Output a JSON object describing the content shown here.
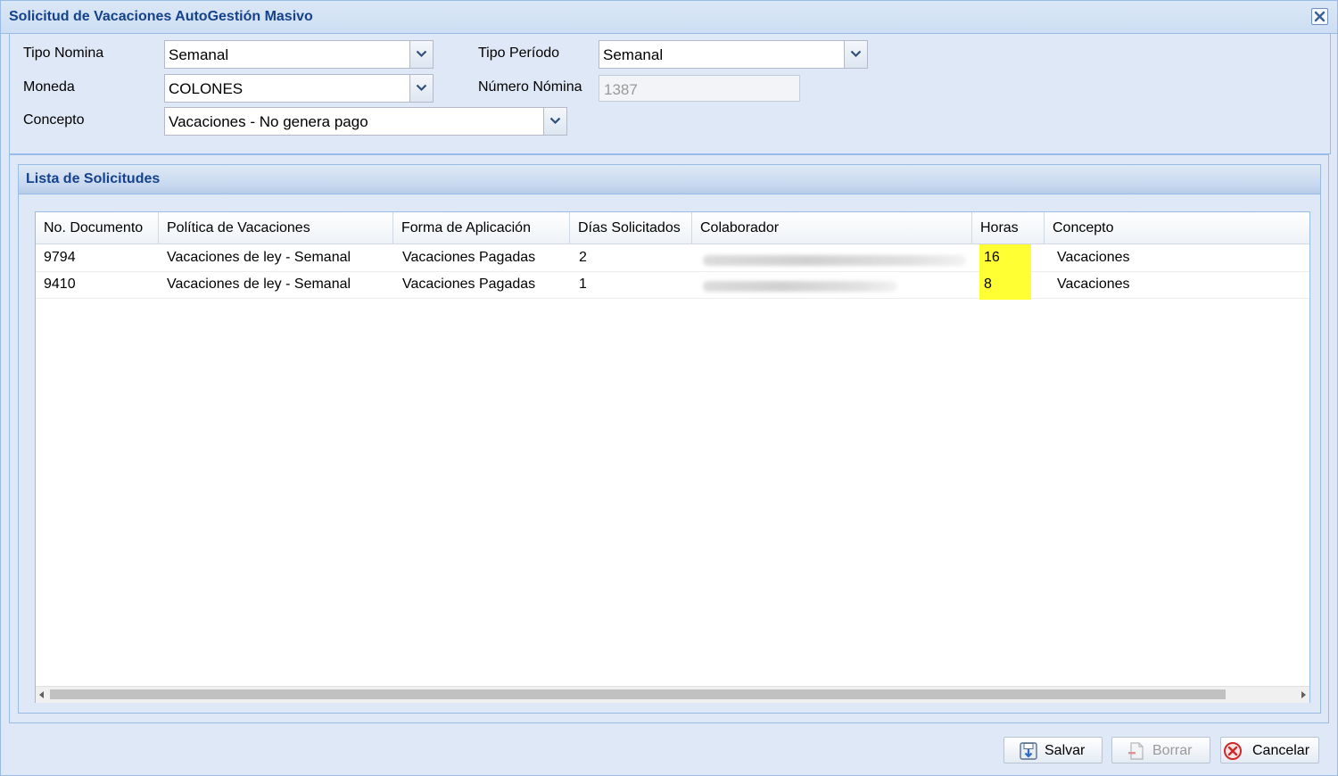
{
  "window": {
    "title": "Solicitud de Vacaciones AutoGestión Masivo"
  },
  "form": {
    "tipo_nomina": {
      "label": "Tipo Nomina",
      "value": "Semanal"
    },
    "tipo_periodo": {
      "label": "Tipo Período",
      "value": "Semanal"
    },
    "moneda": {
      "label": "Moneda",
      "value": "COLONES"
    },
    "numero_nomina": {
      "label": "Número Nómina",
      "value": "1387"
    },
    "concepto": {
      "label": "Concepto",
      "value": "Vacaciones - No genera pago"
    }
  },
  "list": {
    "title": "Lista de Solicitudes",
    "columns": [
      "No. Documento",
      "Política de Vacaciones",
      "Forma de Aplicación",
      "Días Solicitados",
      "Colaborador",
      "Horas",
      "Concepto"
    ],
    "rows": [
      {
        "documento": "9794",
        "politica": "Vacaciones de ley - Semanal",
        "forma": "Vacaciones Pagadas",
        "dias": "2",
        "colaborador": "",
        "horas": "16",
        "concepto": "Vacaciones"
      },
      {
        "documento": "9410",
        "politica": "Vacaciones de ley - Semanal",
        "forma": "Vacaciones Pagadas",
        "dias": "1",
        "colaborador": "",
        "horas": "8",
        "concepto": "Vacaciones"
      }
    ]
  },
  "buttons": {
    "save": "Salvar",
    "delete": "Borrar",
    "cancel": "Cancelar"
  },
  "colors": {
    "title": "#15428b",
    "highlight": "#ffff33",
    "panel": "#dfe8f6",
    "border": "#99bbe8"
  },
  "icons": {
    "close": "close-icon",
    "save": "save-icon",
    "delete": "delete-icon",
    "cancel": "cancel-icon",
    "dropdown": "chevron-down-icon"
  }
}
